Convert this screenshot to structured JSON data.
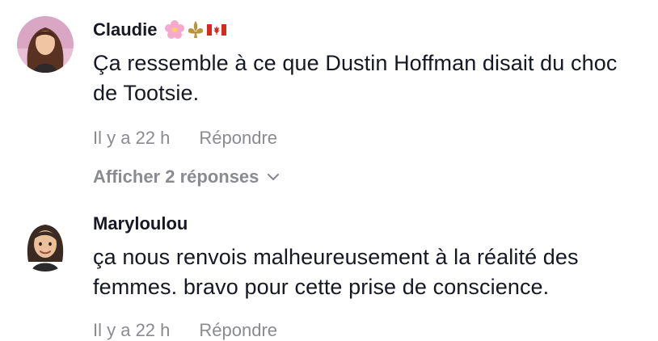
{
  "comments": [
    {
      "username": "Claudie",
      "flair_icons": [
        "cherry-blossom-emoji",
        "fleur-de-lis-emoji",
        "canada-flag-emoji"
      ],
      "text": "Ça ressemble à ce que Dustin Hoffman disait du choc de Tootsie.",
      "time": "Il y a 22 h",
      "reply_label": "Répondre",
      "view_replies_label": "Afficher 2 réponses"
    },
    {
      "username": "Maryloulou",
      "text": "ça nous renvois malheureusement à la réalité des femmes. bravo pour cette prise de conscience.",
      "time": "Il y a 22 h",
      "reply_label": "Répondre"
    }
  ],
  "colors": {
    "primary_text": "#161823",
    "secondary_text": "#8a8b91"
  }
}
